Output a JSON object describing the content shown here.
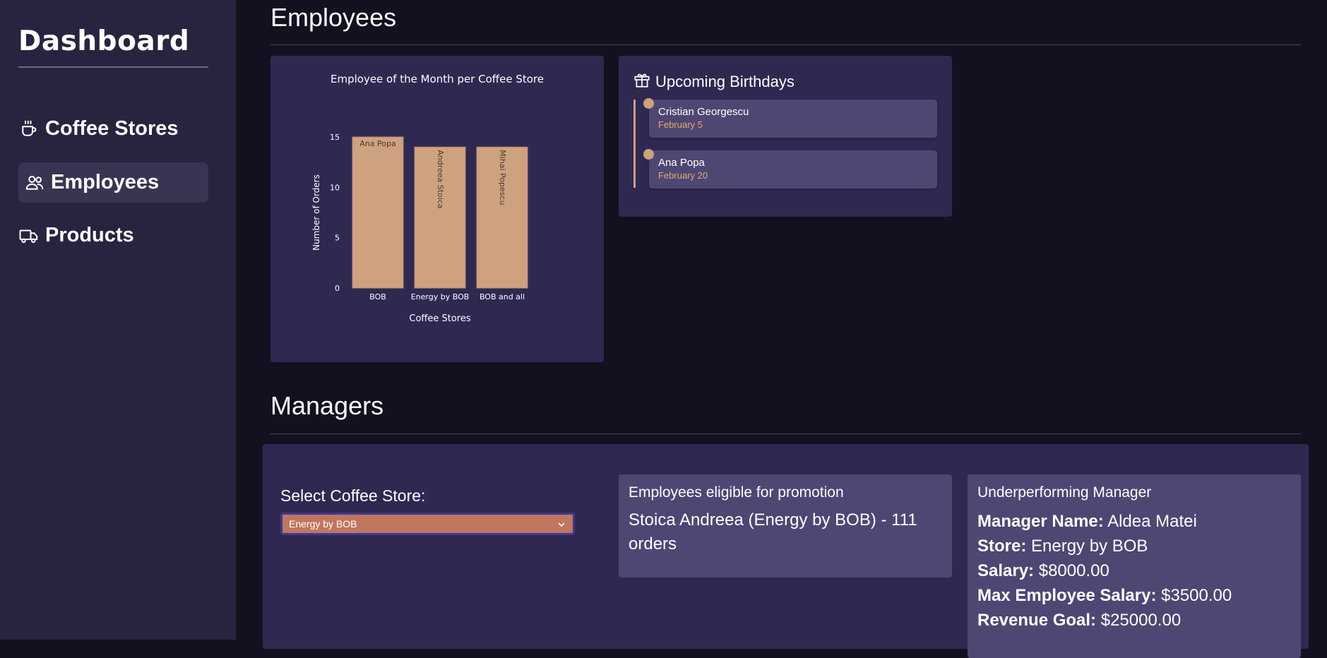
{
  "sidebar": {
    "brand": "Dashboard",
    "items": [
      {
        "label": "Coffee Stores",
        "icon": "coffee-icon",
        "active": false
      },
      {
        "label": "Employees",
        "icon": "users-icon",
        "active": true
      },
      {
        "label": "Products",
        "icon": "truck-icon",
        "active": false
      }
    ]
  },
  "employees": {
    "title": "Employees"
  },
  "chart_data": {
    "type": "bar",
    "title": "Employee of the Month per Coffee Store",
    "xlabel": "Coffee Stores",
    "ylabel": "Number of Orders",
    "categories": [
      "BOB",
      "Energy by BOB",
      "BOB and all"
    ],
    "values": [
      15,
      14,
      14
    ],
    "bar_labels": [
      "Ana Popa",
      "Andreea Stoica",
      "Mihai Popescu"
    ],
    "yticks": [
      0,
      5,
      10,
      15
    ],
    "ylim": [
      0,
      15
    ],
    "bar_color": "#cfa27f"
  },
  "birthdays": {
    "title": "Upcoming Birthdays",
    "items": [
      {
        "name": "Cristian Georgescu",
        "date": "February 5"
      },
      {
        "name": "Ana Popa",
        "date": "February 20"
      }
    ]
  },
  "managers": {
    "title": "Managers",
    "select_label": "Select Coffee Store:",
    "selected_store": "Energy by BOB",
    "promotion": {
      "title": "Employees eligible for promotion",
      "text": "Stoica Andreea (Energy by BOB) - 111 orders"
    },
    "underperforming": {
      "title": "Underperforming Manager",
      "rows": [
        {
          "key": "Manager Name:",
          "value": "Aldea Matei"
        },
        {
          "key": "Store:",
          "value": "Energy by BOB"
        },
        {
          "key": "Salary:",
          "value": "$8000.00"
        },
        {
          "key": "Max Employee Salary:",
          "value": "$3500.00"
        },
        {
          "key": "Revenue Goal:",
          "value": "$25000.00"
        }
      ]
    }
  }
}
